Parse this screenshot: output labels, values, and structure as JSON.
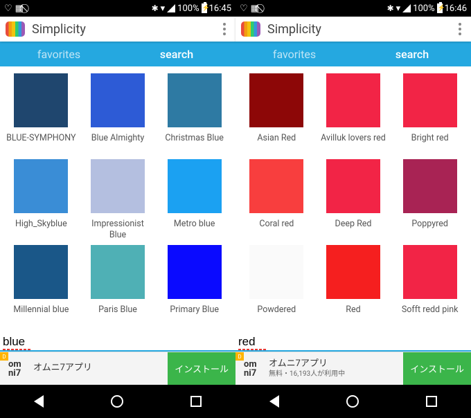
{
  "left": {
    "statusbar": {
      "battery": "100%",
      "time": "16:45"
    },
    "app_title": "Simplicity",
    "tabs": {
      "favorites": "favorites",
      "search": "search"
    },
    "colors": [
      {
        "name": "BLUE-SYMPHONY",
        "hex": "#1f466e"
      },
      {
        "name": "Blue Almighty",
        "hex": "#2d5bd6"
      },
      {
        "name": "Christmas Blue",
        "hex": "#2e7aa3"
      },
      {
        "name": "High_Skyblue",
        "hex": "#3a8dd6"
      },
      {
        "name": "Impressionist Blue",
        "hex": "#b4bfe0"
      },
      {
        "name": "Metro blue",
        "hex": "#1ba1f2"
      },
      {
        "name": "Millennial blue",
        "hex": "#1a5788"
      },
      {
        "name": "Paris Blue",
        "hex": "#4fb0b5"
      },
      {
        "name": "Primary Blue",
        "hex": "#0a0aff"
      }
    ],
    "search_value": "blue",
    "ad": {
      "logo": "om\nni7",
      "title": "オムニ7アプリ",
      "sub": "",
      "cta": "インストール",
      "tag": "D"
    }
  },
  "right": {
    "statusbar": {
      "battery": "100%",
      "time": "16:46"
    },
    "app_title": "Simplicity",
    "tabs": {
      "favorites": "favorites",
      "search": "search"
    },
    "colors": [
      {
        "name": "Asian Red",
        "hex": "#8d0707"
      },
      {
        "name": "Avilluk lovers red",
        "hex": "#f22446"
      },
      {
        "name": "Bright red",
        "hex": "#f22446"
      },
      {
        "name": "Coral red",
        "hex": "#f83e3e"
      },
      {
        "name": "Deep Red",
        "hex": "#f22446"
      },
      {
        "name": "Poppyred",
        "hex": "#a82354"
      },
      {
        "name": "Powdered",
        "hex": "#fafafa"
      },
      {
        "name": "Red",
        "hex": "#f51f1f"
      },
      {
        "name": "Sofft redd pink",
        "hex": "#f22446"
      }
    ],
    "search_value": "red",
    "ad": {
      "logo": "om\nni7",
      "title": "オムニ7アプリ",
      "sub": "無料・16,193人が利用中",
      "cta": "インストール",
      "tag": "D"
    }
  }
}
